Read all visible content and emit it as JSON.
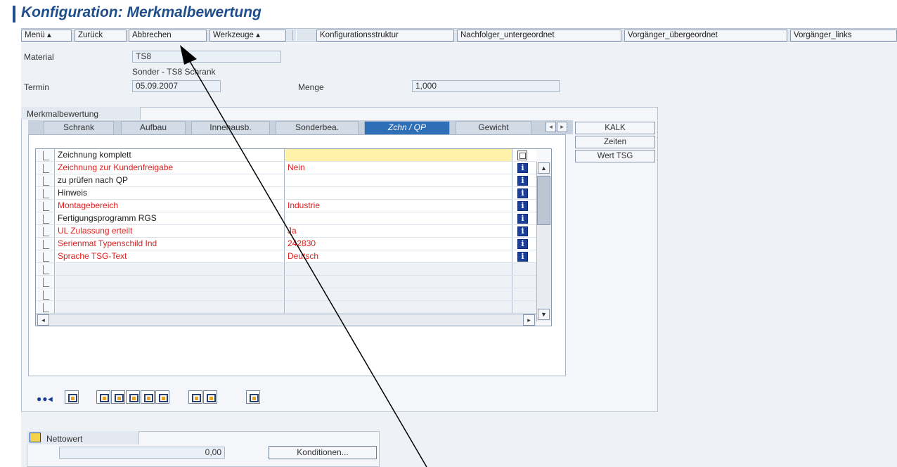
{
  "window": {
    "title": "Konfiguration: Merkmalbewertung"
  },
  "toolbar": {
    "buttons": [
      "Menü ▴",
      "Zurück",
      "Abbrechen",
      "Werkzeuge ▴",
      "Konfigurationsstruktur",
      "Nachfolger_untergeordnet",
      "Vorgänger_übergeordnet",
      "Vorgänger_links"
    ]
  },
  "header": {
    "material_label": "Material",
    "material_value": "TS8",
    "material_description": "Sonder - TS8 Schrank",
    "termin_label": "Termin",
    "termin_value": "05.09.2007",
    "menge_label": "Menge",
    "menge_value": "1,000"
  },
  "group": {
    "title": "Merkmalbewertung",
    "tabs": [
      "Schrank",
      "Aufbau",
      "Innenausb.",
      "Sonderbea.",
      "Zchn / QP",
      "Gewicht"
    ],
    "active_tab": "Zchn / QP",
    "side_buttons": [
      "KALK",
      "Zeiten",
      "Wert TSG"
    ]
  },
  "table": {
    "rows": [
      {
        "name": "Zeichnung komplett",
        "value": "",
        "required": false,
        "icon": "copy-icon"
      },
      {
        "name": "Zeichnung zur Kundenfreigabe",
        "value": "Nein",
        "required": true,
        "icon": "info-icon"
      },
      {
        "name": "zu prüfen nach QP",
        "value": "",
        "required": false,
        "icon": "info-icon"
      },
      {
        "name": "Hinweis",
        "value": "",
        "required": false,
        "icon": "info-icon"
      },
      {
        "name": "Montagebereich",
        "value": "Industrie",
        "required": true,
        "icon": "info-icon"
      },
      {
        "name": "Fertigungsprogramm RGS",
        "value": "",
        "required": false,
        "icon": "info-icon"
      },
      {
        "name": "UL Zulassung erteilt",
        "value": "Ja",
        "required": true,
        "icon": "info-icon"
      },
      {
        "name": "Serienmat Typenschild Ind",
        "value": "242830",
        "required": true,
        "icon": "info-icon"
      },
      {
        "name": "Sprache TSG-Text",
        "value": "Deutsch",
        "required": true,
        "icon": "info-icon"
      },
      {
        "name": "",
        "value": "",
        "required": false,
        "icon": ""
      },
      {
        "name": "",
        "value": "",
        "required": false,
        "icon": ""
      },
      {
        "name": "",
        "value": "",
        "required": false,
        "icon": ""
      },
      {
        "name": "",
        "value": "",
        "required": false,
        "icon": ""
      }
    ]
  },
  "netto": {
    "label": "Nettowert",
    "value": "0,00",
    "conditions_button": "Konditionen..."
  },
  "colors": {
    "title_blue": "#1f4e8c",
    "active_tab": "#2f6fb8",
    "required_red": "#e02020",
    "input_highlight": "#fff1a8",
    "info_icon": "#1a3f9a"
  }
}
